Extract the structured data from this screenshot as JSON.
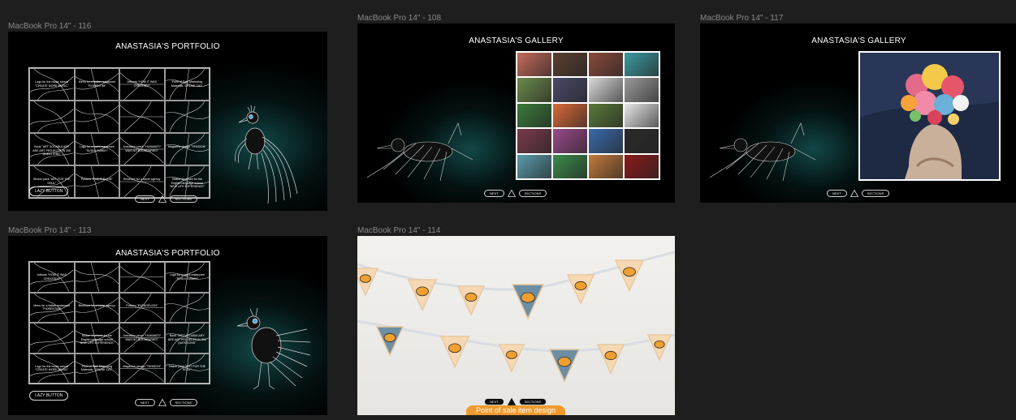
{
  "frames": {
    "f116": {
      "label": "MacBook Pro 14\" - 116",
      "title": "ANASTASIA'S PORTFOLIO",
      "lazy_button": "LAZY BUTTON",
      "next": "NEXT",
      "sections": "SECTIONS",
      "cells": [
        "Logo for the music school \"CREATE MORE MUSIC\"",
        "Menu for a Italian restaurant \"FIORENTINI\"",
        "Artbook \"HOW IT WAS CREATED?\"",
        "Point of Sale Marketing Materials \"DRUNK CAT\"",
        "",
        "",
        "",
        "",
        "Book \"ART VOCABULARY ARE ART PROJECTS IN 300 QUESTIONS\"",
        "Logo for a sushi restaurant \"SUSHI YUMMY\"",
        "Animation piece \"HUMANITY WAS NO BOUNDARIES\"",
        "Magazine design \"TENSION\"",
        "Sticker pack \"ART FOR THE SOUL\"",
        "Posters \"EVANGELION\"",
        "Brochure for a travel agency",
        "Sticker brochure for the English language school \"NEW LIFE EXPERIENCE\""
      ]
    },
    "f108": {
      "label": "MacBook Pro 14\" - 108",
      "title": "ANASTASIA'S GALLERY",
      "next": "NEXT",
      "sections": "SECTIONS",
      "thumbs": [
        "#c46b5a",
        "#5a3f30",
        "#8b4a3c",
        "#3b9aa0",
        "#6a8a4a",
        "#4a4a6a",
        "#d9d9d9",
        "#9a9a9a",
        "#3b7a3a",
        "#d96a3a",
        "#5a7a3a",
        "#e8e8e8",
        "#7a3a4a",
        "#9a4a8a",
        "#3a6aaa",
        "#2a2a2a",
        "#5a9aaa",
        "#3a8a4a",
        "#c47a3a",
        "#8a1a1a"
      ]
    },
    "f117": {
      "label": "MacBook Pro 14\" - 117",
      "title": "ANASTASIA'S GALLERY",
      "next": "NEXT",
      "sections": "SECTIONS"
    },
    "f113": {
      "label": "MacBook Pro 14\" - 113",
      "title": "ANASTASIA'S PORTFOLIO",
      "lazy_button": "LAZY BUTTON",
      "next": "NEXT",
      "sections": "SECTIONS",
      "cells": [
        "Artbook \"HOW IT WAS CREATED?\"",
        "",
        "",
        "Logo for a sushi restaurant \"SUSHI YUMMY\"",
        "Menu for a Italian restaurant \"FIORENTINI\"",
        "Brochure for a travel agency",
        "Posters \"EVANGELION\"",
        "",
        "",
        "Sticker brochure for the English language school \"NEW LIFE EXPERIENCE\"",
        "Animation piece \"HUMANITY WAS NO BOUNDARIES\"",
        "Book \"ART VOCABULARY ARE ART PROJECTS IN 300 QUESTIONS\"",
        "Logo for the music school \"CREATE MORE MUSIC\"",
        "Point of Sale Marketing Materials \"DRUNK CAT\"",
        "Magazine design \"TENSION\"",
        "Sticker pack \"ART FOR THE SOUL\""
      ]
    },
    "f114": {
      "label": "MacBook Pro 14\" - 114",
      "next": "NEXT",
      "sections": "SECTIONS",
      "caption": "Point of sale item design"
    }
  },
  "colors": {
    "canvas_bg": "#1e1e1e",
    "frame_bg": "#000000",
    "glow": "#195f5f",
    "flag_peach": "#f6d9b4",
    "flag_blue": "#6d8fa3",
    "cat_orange": "#f0a030",
    "caption_orange": "#f09a2c"
  }
}
